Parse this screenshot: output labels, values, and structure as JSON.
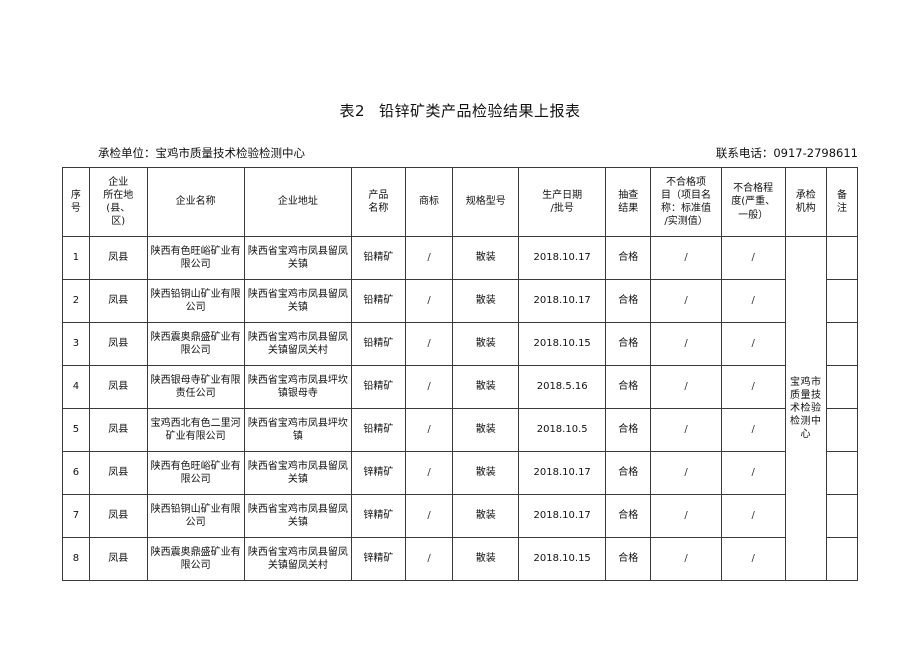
{
  "document": {
    "title_number": "表2",
    "title_text": "铅锌矿类产品检验结果上报表",
    "inspection_unit_label": "承检单位：宝鸡市质量技术检验检测中心",
    "contact_label": "联系电话：0917-2798611"
  },
  "table": {
    "headers": {
      "seq": "序号",
      "location_line1": "企业",
      "location_line2": "所在地(县、",
      "location_line3": "区)",
      "company_name": "企业名称",
      "company_address": "企业地址",
      "product_line1": "产品",
      "product_line2": "名称",
      "brand": "商标",
      "spec": "规格型号",
      "date_line1": "生产日期",
      "date_line2": "/批号",
      "result_line1": "抽查",
      "result_line2": "结果",
      "fail_item_line1": "不合格项",
      "fail_item_line2": "目（项目名",
      "fail_item_line3": "称：标准值",
      "fail_item_line4": "/实测值）",
      "fail_degree_line1": "不合格程",
      "fail_degree_line2": "度(严重、",
      "fail_degree_line3": "一般）",
      "org_line1": "承检",
      "org_line2": "机构",
      "note_line1": "备",
      "note_line2": "注"
    },
    "merged_org_cell": "宝鸡市质量技术检验检测中心",
    "rows": [
      {
        "seq": "1",
        "location": "凤县",
        "company_name": "陕西有色旺峪矿业有限公司",
        "company_address": "陕西省宝鸡市凤县留凤关镇",
        "product": "铅精矿",
        "brand": "/",
        "spec": "散装",
        "date": "2018.10.17",
        "result": "合格",
        "fail_item": "/",
        "fail_degree": "/",
        "note": ""
      },
      {
        "seq": "2",
        "location": "凤县",
        "company_name": "陕西铅铜山矿业有限公司",
        "company_address": "陕西省宝鸡市凤县留凤关镇",
        "product": "铅精矿",
        "brand": "/",
        "spec": "散装",
        "date": "2018.10.17",
        "result": "合格",
        "fail_item": "/",
        "fail_degree": "/",
        "note": ""
      },
      {
        "seq": "3",
        "location": "凤县",
        "company_name": "陕西震奥鼎盛矿业有限公司",
        "company_address": "陕西省宝鸡市凤县留凤关镇留凤关村",
        "product": "铅精矿",
        "brand": "/",
        "spec": "散装",
        "date": "2018.10.15",
        "result": "合格",
        "fail_item": "/",
        "fail_degree": "/",
        "note": ""
      },
      {
        "seq": "4",
        "location": "凤县",
        "company_name": "陕西银母寺矿业有限责任公司",
        "company_address": "陕西省宝鸡市凤县坪坎镇银母寺",
        "product": "铅精矿",
        "brand": "/",
        "spec": "散装",
        "date": "2018.5.16",
        "result": "合格",
        "fail_item": "/",
        "fail_degree": "/",
        "note": ""
      },
      {
        "seq": "5",
        "location": "凤县",
        "company_name": "宝鸡西北有色二里河矿业有限公司",
        "company_address": "陕西省宝鸡市凤县坪坎镇",
        "product": "铅精矿",
        "brand": "/",
        "spec": "散装",
        "date": "2018.10.5",
        "result": "合格",
        "fail_item": "/",
        "fail_degree": "/",
        "note": ""
      },
      {
        "seq": "6",
        "location": "凤县",
        "company_name": "陕西有色旺峪矿业有限公司",
        "company_address": "陕西省宝鸡市凤县留凤关镇",
        "product": "锌精矿",
        "brand": "/",
        "spec": "散装",
        "date": "2018.10.17",
        "result": "合格",
        "fail_item": "/",
        "fail_degree": "/",
        "note": ""
      },
      {
        "seq": "7",
        "location": "凤县",
        "company_name": "陕西铅铜山矿业有限公司",
        "company_address": "陕西省宝鸡市凤县留凤关镇",
        "product": "锌精矿",
        "brand": "/",
        "spec": "散装",
        "date": "2018.10.17",
        "result": "合格",
        "fail_item": "/",
        "fail_degree": "/",
        "note": ""
      },
      {
        "seq": "8",
        "location": "凤县",
        "company_name": "陕西震奥鼎盛矿业有限公司",
        "company_address": "陕西省宝鸡市凤县留凤关镇留凤关村",
        "product": "锌精矿",
        "brand": "/",
        "spec": "散装",
        "date": "2018.10.15",
        "result": "合格",
        "fail_item": "/",
        "fail_degree": "/",
        "note": ""
      }
    ]
  }
}
